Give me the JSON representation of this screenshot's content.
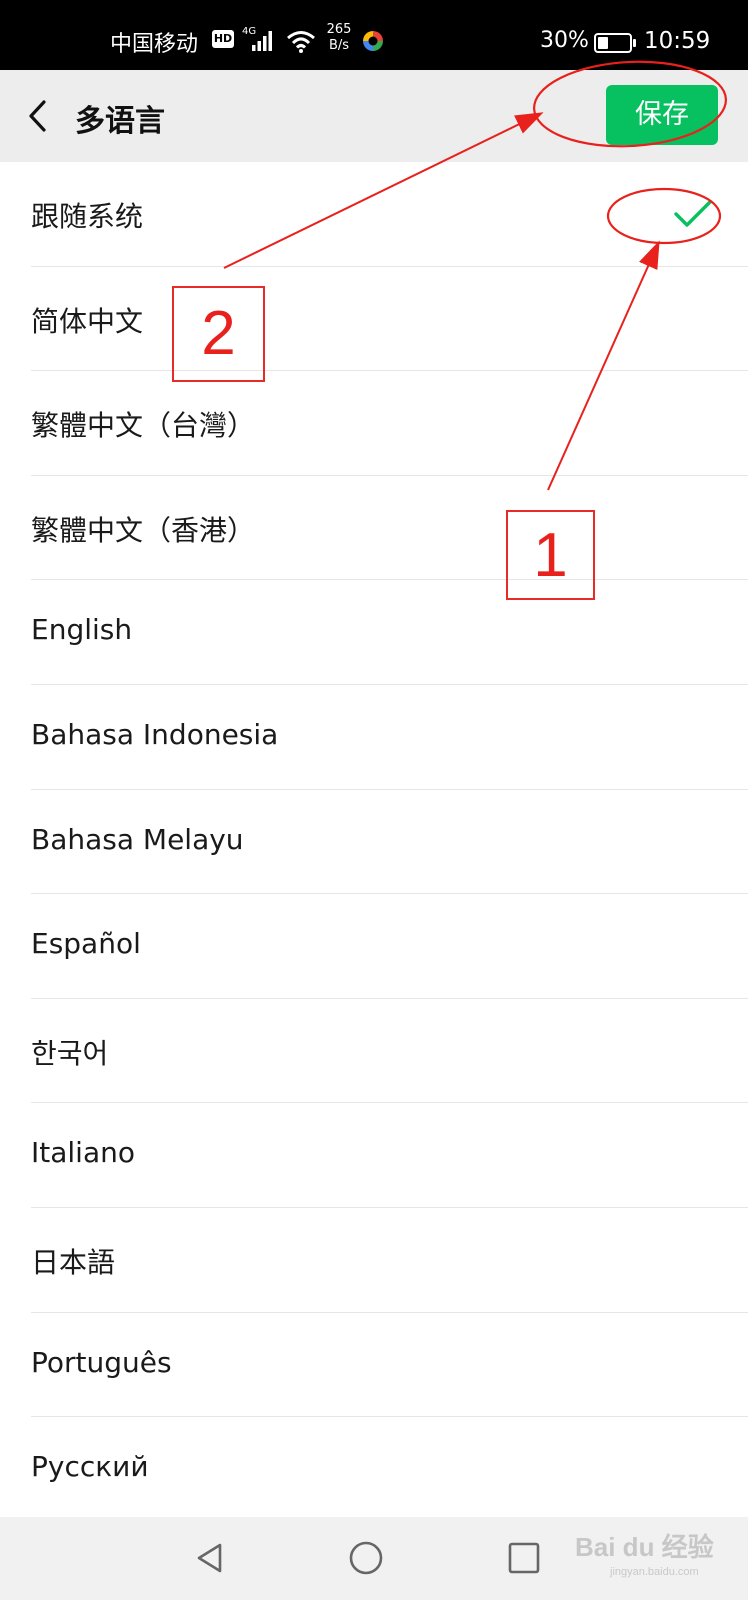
{
  "status_bar": {
    "carrier": "中国移动",
    "hd_badge": "HD",
    "network_type": "4G",
    "speed_value": "265",
    "speed_unit": "B/s",
    "battery": "30%",
    "time": "10:59"
  },
  "header": {
    "back_icon": "chevron-left-icon",
    "title": "多语言",
    "save_label": "保存",
    "save_color": "#07c160"
  },
  "languages": [
    {
      "label": "跟随系统",
      "selected": true
    },
    {
      "label": "简体中文",
      "selected": false
    },
    {
      "label": "繁體中文（台灣）",
      "selected": false
    },
    {
      "label": "繁體中文（香港）",
      "selected": false
    },
    {
      "label": "English",
      "selected": false
    },
    {
      "label": "Bahasa Indonesia",
      "selected": false
    },
    {
      "label": "Bahasa Melayu",
      "selected": false
    },
    {
      "label": "Español",
      "selected": false
    },
    {
      "label": "한국어",
      "selected": false
    },
    {
      "label": "Italiano",
      "selected": false
    },
    {
      "label": "日本語",
      "selected": false
    },
    {
      "label": "Português",
      "selected": false
    },
    {
      "label": "Русский",
      "selected": false
    }
  ],
  "check_color": "#07c160",
  "annotations": {
    "step1": "1",
    "step2": "2",
    "annotation_color": "#e8211c"
  },
  "watermark": {
    "brand": "Bai du 经验",
    "sub": "jingyan.baidu.com"
  }
}
